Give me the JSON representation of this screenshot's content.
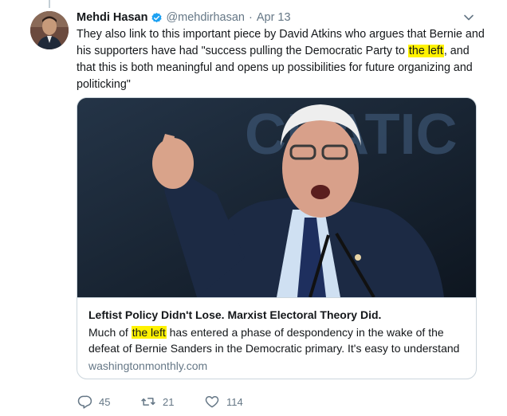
{
  "tweet": {
    "author_name": "Mehdi Hasan",
    "handle": "@mehdirhasan",
    "separator": "·",
    "date": "Apr 13",
    "text_before": "They also link to this important piece by David Atkins who argues that Bernie and his supporters have had \"success pulling the Democratic Party to ",
    "text_highlight": "the left",
    "text_after": ", and that this is both meaningful and opens up possibilities for future organizing and politicking\""
  },
  "card": {
    "title": "Leftist Policy Didn't Lose. Marxist Electoral Theory Did.",
    "desc_before": "Much of ",
    "desc_highlight": "the left",
    "desc_after": " has entered a phase of despondency in the wake of the defeat of Bernie Sanders in the Democratic primary. It's easy to understand",
    "domain": "washingtonmonthly.com",
    "image_text": "CRATIC"
  },
  "actions": {
    "replies": "45",
    "retweets": "21",
    "likes": "114"
  },
  "colors": {
    "verified": "#1da1f2",
    "muted": "#657786",
    "highlight": "#fff200"
  }
}
